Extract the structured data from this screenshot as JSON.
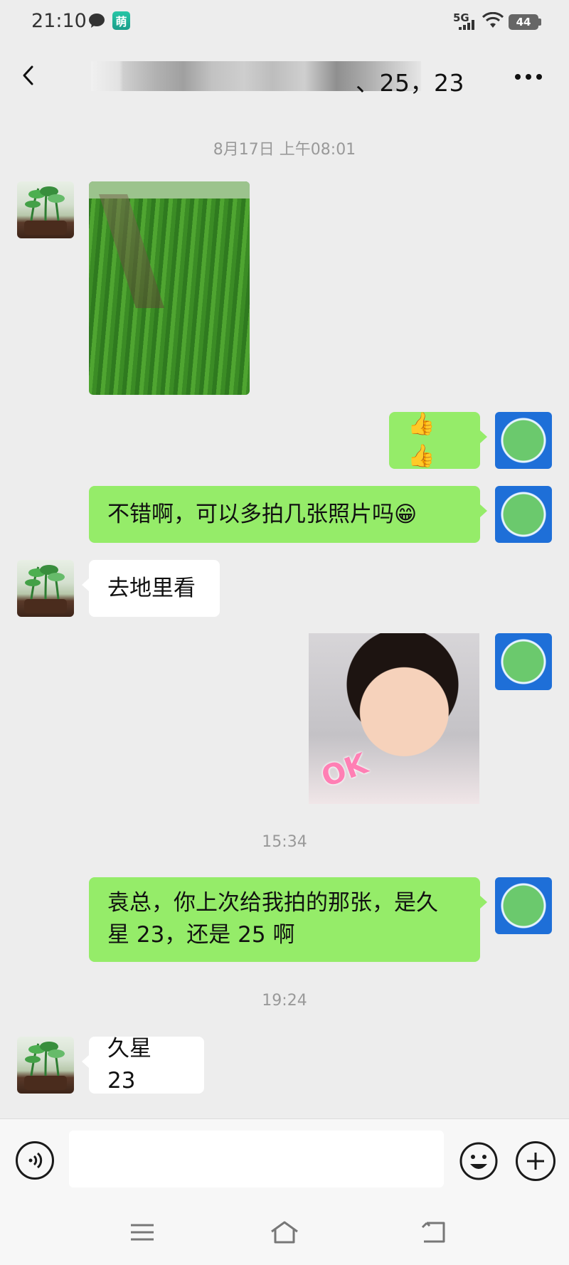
{
  "status_bar": {
    "time": "21:10",
    "network": "5G",
    "battery": "44",
    "app_icon_text": "萌"
  },
  "header": {
    "title_visible": "、25，23"
  },
  "messages": {
    "timestamp_1": "8月17日 上午08:01",
    "msg_emoji_thumbs": "👍👍",
    "msg_request": "不错啊，可以多拍几张照片吗😁",
    "msg_reply_1": "去地里看",
    "sticker_text": "OK",
    "timestamp_2": "15:34",
    "msg_question_line1": "袁总，你上次给我拍的那张，是久",
    "msg_question_line2": "星 23，还是 25 啊",
    "timestamp_3": "19:24",
    "msg_reply_2": "久星 23"
  },
  "input": {
    "placeholder": ""
  },
  "colors": {
    "outgoing_bubble": "#95ec69",
    "incoming_bubble": "#ffffff",
    "background": "#ededed"
  },
  "icons": {
    "back": "chevron-left-icon",
    "more": "more-dots-icon",
    "voice": "voice-icon",
    "emoji": "emoji-icon",
    "plus": "plus-icon",
    "nav_menu": "menu-icon",
    "nav_home": "home-icon",
    "nav_back": "back-icon"
  }
}
